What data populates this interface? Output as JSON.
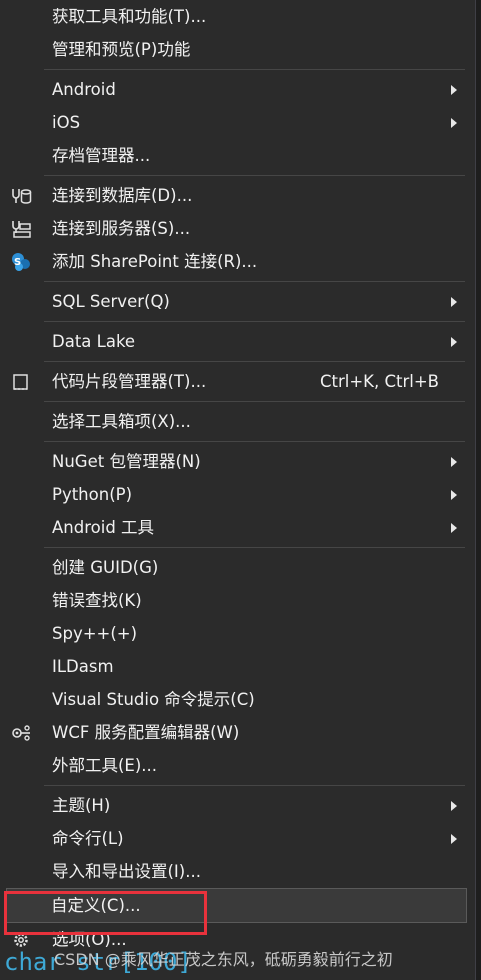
{
  "menu": {
    "group1": [
      {
        "label": "获取工具和功能(T)..."
      },
      {
        "label": "管理和预览(P)功能"
      }
    ],
    "group2": [
      {
        "label": "Android"
      },
      {
        "label": "iOS"
      },
      {
        "label": "存档管理器..."
      }
    ],
    "group3": [
      {
        "label": "连接到数据库(D)...",
        "icon": "database-connect-icon"
      },
      {
        "label": "连接到服务器(S)...",
        "icon": "server-connect-icon"
      },
      {
        "label": "添加 SharePoint 连接(R)...",
        "icon": "sharepoint-icon"
      }
    ],
    "sql_server": "SQL Server(Q)",
    "data_lake": "Data Lake",
    "snippets": {
      "label": "代码片段管理器(T)...",
      "shortcut": "Ctrl+K, Ctrl+B",
      "icon": "snippet-icon"
    },
    "choose_toolbox": "选择工具箱项(X)...",
    "group6": [
      {
        "label": "NuGet 包管理器(N)"
      },
      {
        "label": "Python(P)"
      },
      {
        "label": "Android 工具"
      }
    ],
    "group7": [
      {
        "label": "创建 GUID(G)"
      },
      {
        "label": "错误查找(K)"
      },
      {
        "label": "Spy++(+)"
      },
      {
        "label": "ILDasm"
      },
      {
        "label": "Visual Studio 命令提示(C)"
      },
      {
        "label": "WCF 服务配置编辑器(W)",
        "icon": "wcf-config-icon"
      },
      {
        "label": "外部工具(E)..."
      }
    ],
    "group8": [
      {
        "label": "主题(H)"
      },
      {
        "label": "命令行(L)"
      },
      {
        "label": "导入和导出设置(I)..."
      },
      {
        "label": "自定义(C)..."
      },
      {
        "label": "选项(O)...",
        "icon": "gear-icon"
      }
    ]
  },
  "background_code": "char  str[100]",
  "watermark": "CSDN @乘风华正茂之东风，砥砺勇毅前行之初",
  "colors": {
    "menu_bg": "#2b2b2b",
    "text": "#f1f1f1",
    "highlight_box": "#e8323c",
    "code_blue": "#3ea9d6"
  }
}
